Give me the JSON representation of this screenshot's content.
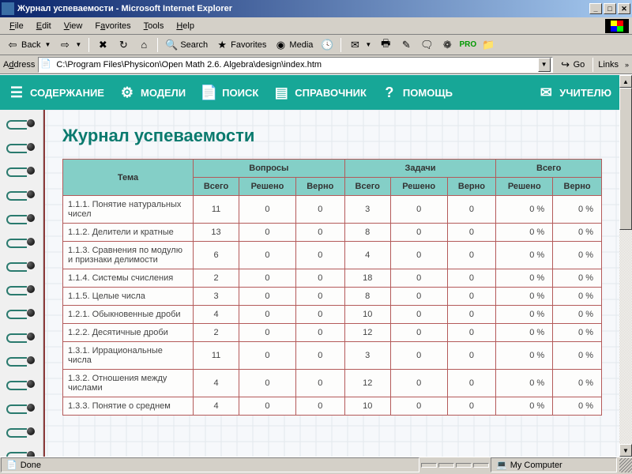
{
  "window": {
    "title": "Журнал успеваемости - Microsoft Internet Explorer"
  },
  "menubar": {
    "file": "File",
    "edit": "Edit",
    "view": "View",
    "favorites": "Favorites",
    "tools": "Tools",
    "help": "Help"
  },
  "toolbar": {
    "back": "Back",
    "search": "Search",
    "favorites": "Favorites",
    "media": "Media"
  },
  "addressbar": {
    "label": "Address",
    "value": "C:\\Program Files\\Physicon\\Open Math 2.6. Algebra\\design\\index.htm",
    "go": "Go",
    "links": "Links"
  },
  "nav": {
    "contents": "СОДЕРЖАНИЕ",
    "models": "МОДЕЛИ",
    "search": "ПОИСК",
    "reference": "СПРАВОЧНИК",
    "help": "ПОМОЩЬ",
    "teacher": "УЧИТЕЛЮ"
  },
  "page": {
    "title": "Журнал успеваемости"
  },
  "table": {
    "headers": {
      "topic": "Тема",
      "questions": "Вопросы",
      "tasks": "Задачи",
      "total": "Всего",
      "all": "Всего",
      "solved": "Решено",
      "correct": "Верно"
    },
    "rows": [
      {
        "topic": "1.1.1. Понятие натуральных чисел",
        "q_all": 11,
        "q_solved": 0,
        "q_correct": 0,
        "t_all": 3,
        "t_solved": 0,
        "t_correct": 0,
        "tot_solved": "0 %",
        "tot_correct": "0 %"
      },
      {
        "topic": "1.1.2. Делители и кратные",
        "q_all": 13,
        "q_solved": 0,
        "q_correct": 0,
        "t_all": 8,
        "t_solved": 0,
        "t_correct": 0,
        "tot_solved": "0 %",
        "tot_correct": "0 %"
      },
      {
        "topic": "1.1.3. Сравнения по модулю и признаки делимости",
        "q_all": 6,
        "q_solved": 0,
        "q_correct": 0,
        "t_all": 4,
        "t_solved": 0,
        "t_correct": 0,
        "tot_solved": "0 %",
        "tot_correct": "0 %"
      },
      {
        "topic": "1.1.4. Системы счисления",
        "q_all": 2,
        "q_solved": 0,
        "q_correct": 0,
        "t_all": 18,
        "t_solved": 0,
        "t_correct": 0,
        "tot_solved": "0 %",
        "tot_correct": "0 %"
      },
      {
        "topic": "1.1.5. Целые числа",
        "q_all": 3,
        "q_solved": 0,
        "q_correct": 0,
        "t_all": 8,
        "t_solved": 0,
        "t_correct": 0,
        "tot_solved": "0 %",
        "tot_correct": "0 %"
      },
      {
        "topic": "1.2.1. Обыкновенные дроби",
        "q_all": 4,
        "q_solved": 0,
        "q_correct": 0,
        "t_all": 10,
        "t_solved": 0,
        "t_correct": 0,
        "tot_solved": "0 %",
        "tot_correct": "0 %"
      },
      {
        "topic": "1.2.2. Десятичные дроби",
        "q_all": 2,
        "q_solved": 0,
        "q_correct": 0,
        "t_all": 12,
        "t_solved": 0,
        "t_correct": 0,
        "tot_solved": "0 %",
        "tot_correct": "0 %"
      },
      {
        "topic": "1.3.1. Иррациональные числа",
        "q_all": 11,
        "q_solved": 0,
        "q_correct": 0,
        "t_all": 3,
        "t_solved": 0,
        "t_correct": 0,
        "tot_solved": "0 %",
        "tot_correct": "0 %"
      },
      {
        "topic": "1.3.2. Отношения между числами",
        "q_all": 4,
        "q_solved": 0,
        "q_correct": 0,
        "t_all": 12,
        "t_solved": 0,
        "t_correct": 0,
        "tot_solved": "0 %",
        "tot_correct": "0 %"
      },
      {
        "topic": "1.3.3. Понятие о среднем",
        "q_all": 4,
        "q_solved": 0,
        "q_correct": 0,
        "t_all": 10,
        "t_solved": 0,
        "t_correct": 0,
        "tot_solved": "0 %",
        "tot_correct": "0 %"
      }
    ]
  },
  "statusbar": {
    "status": "Done",
    "zone": "My Computer"
  }
}
